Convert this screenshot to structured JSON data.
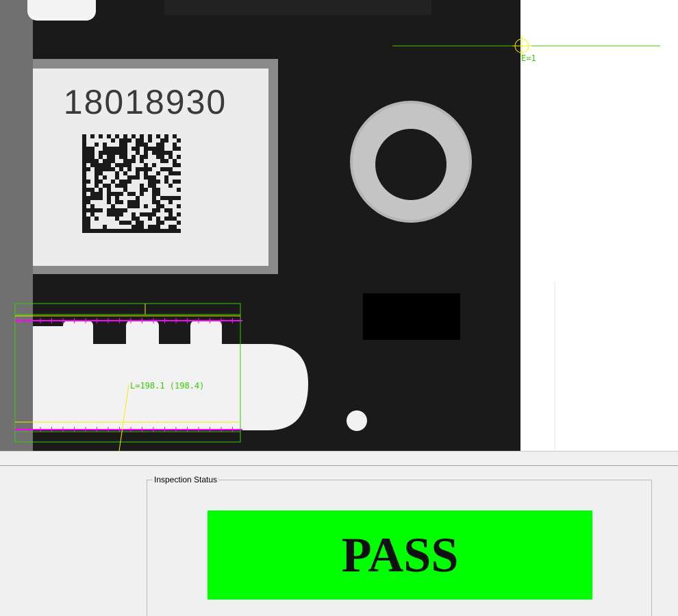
{
  "image": {
    "part_number": "18018930",
    "edge_label": "E=1",
    "length_label": "L=198.1 (198.4)"
  },
  "status_panel": {
    "group_title": "Inspection Status",
    "result": "PASS",
    "result_color": "#00ff00"
  },
  "colors": {
    "overlay_green": "#33cc00",
    "overlay_yellow": "#f0f000",
    "overlay_magenta": "#ff00ff"
  }
}
